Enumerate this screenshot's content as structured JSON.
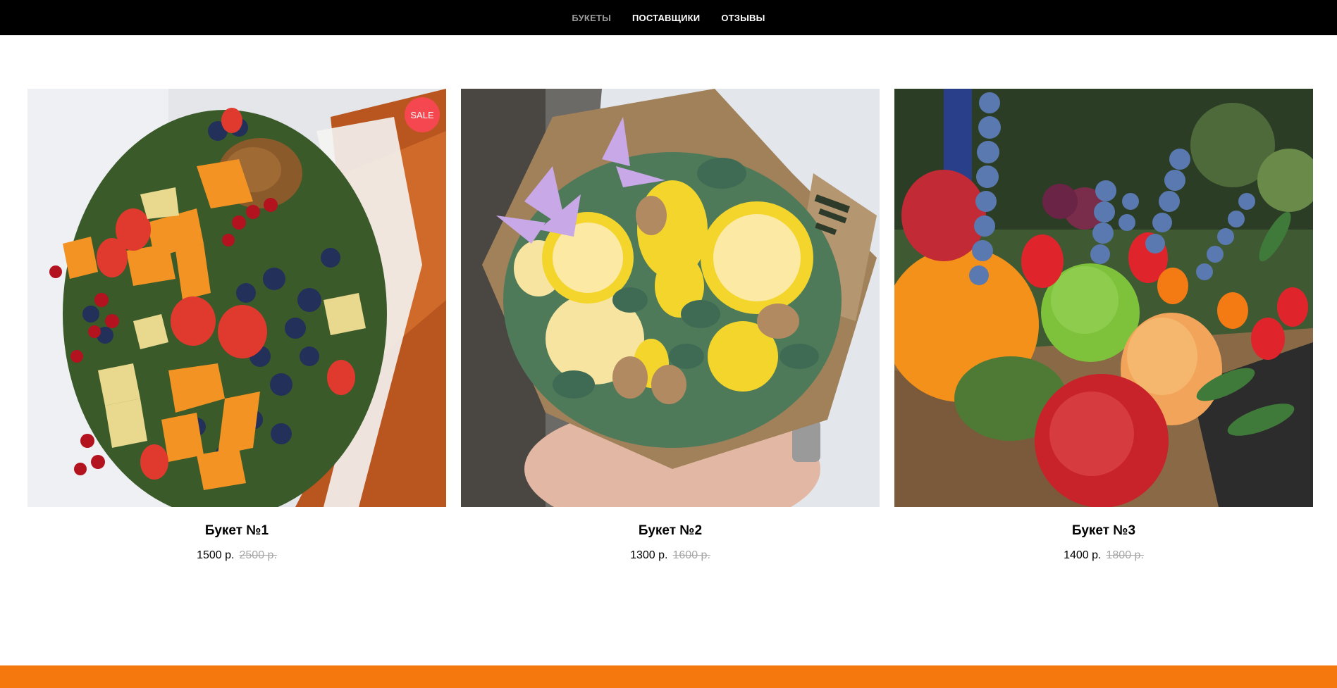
{
  "nav": {
    "items": [
      {
        "label": "БУКЕТЫ",
        "active": true
      },
      {
        "label": "ПОСТАВЩИКИ",
        "active": false
      },
      {
        "label": "ОТЗЫВЫ",
        "active": false
      }
    ]
  },
  "products": [
    {
      "title": "Букет №1",
      "price": "1500 р.",
      "old_price": "2500 р.",
      "badge": "SALE",
      "image_alt": "Фруктово-ягодный букет с сыром и орехами"
    },
    {
      "title": "Букет №2",
      "price": "1300 р.",
      "old_price": "1600 р.",
      "image_alt": "Букет с лимонами, грушей и имбирем"
    },
    {
      "title": "Букет №3",
      "price": "1400 р.",
      "old_price": "1800 р.",
      "image_alt": "Букет с яблоком, лаймом, клубникой и голубикой"
    }
  ],
  "colors": {
    "header_bg": "#000000",
    "nav_active": "#9c9c9c",
    "sale_badge": "#f5474f",
    "footer_band": "#f5780f",
    "old_price": "#a6a6a6"
  }
}
